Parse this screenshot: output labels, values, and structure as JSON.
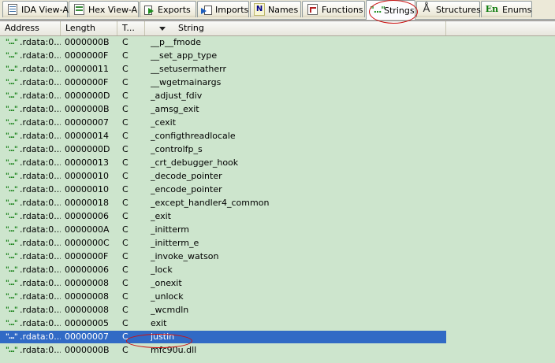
{
  "tabs": [
    {
      "label": "IDA View-A",
      "icon": "ida-view-icon",
      "active": false
    },
    {
      "label": "Hex View-A",
      "icon": "hex-view-icon",
      "active": false
    },
    {
      "label": "Exports",
      "icon": "exports-icon",
      "active": false
    },
    {
      "label": "Imports",
      "icon": "imports-icon",
      "active": false
    },
    {
      "label": "Names",
      "icon": "names-icon",
      "active": false
    },
    {
      "label": "Functions",
      "icon": "functions-icon",
      "active": false
    },
    {
      "label": "Strings",
      "icon": "strings-icon",
      "active": true
    },
    {
      "label": "Structures",
      "icon": "structures-icon",
      "active": false
    },
    {
      "label": "Enums",
      "icon": "enums-icon",
      "active": false
    }
  ],
  "tab_glyphs": {
    "names": "N",
    "strings": "\"...\"",
    "structures": "Å",
    "enums": "En"
  },
  "columns": {
    "address": "Address",
    "length": "Length",
    "type": "T...",
    "string": "String"
  },
  "row_icon": "\"...\"",
  "rows": [
    {
      "address": ".rdata:0...",
      "length": "0000000B",
      "type": "C",
      "string": "__p__fmode"
    },
    {
      "address": ".rdata:0...",
      "length": "0000000F",
      "type": "C",
      "string": "__set_app_type"
    },
    {
      "address": ".rdata:0...",
      "length": "00000011",
      "type": "C",
      "string": "__setusermatherr"
    },
    {
      "address": ".rdata:0...",
      "length": "0000000F",
      "type": "C",
      "string": "__wgetmainargs"
    },
    {
      "address": ".rdata:0...",
      "length": "0000000D",
      "type": "C",
      "string": "_adjust_fdiv"
    },
    {
      "address": ".rdata:0...",
      "length": "0000000B",
      "type": "C",
      "string": "_amsg_exit"
    },
    {
      "address": ".rdata:0...",
      "length": "00000007",
      "type": "C",
      "string": "_cexit"
    },
    {
      "address": ".rdata:0...",
      "length": "00000014",
      "type": "C",
      "string": "_configthreadlocale"
    },
    {
      "address": ".rdata:0...",
      "length": "0000000D",
      "type": "C",
      "string": "_controlfp_s"
    },
    {
      "address": ".rdata:0...",
      "length": "00000013",
      "type": "C",
      "string": "_crt_debugger_hook"
    },
    {
      "address": ".rdata:0...",
      "length": "00000010",
      "type": "C",
      "string": "_decode_pointer"
    },
    {
      "address": ".rdata:0...",
      "length": "00000010",
      "type": "C",
      "string": "_encode_pointer"
    },
    {
      "address": ".rdata:0...",
      "length": "00000018",
      "type": "C",
      "string": "_except_handler4_common"
    },
    {
      "address": ".rdata:0...",
      "length": "00000006",
      "type": "C",
      "string": "_exit"
    },
    {
      "address": ".rdata:0...",
      "length": "0000000A",
      "type": "C",
      "string": "_initterm"
    },
    {
      "address": ".rdata:0...",
      "length": "0000000C",
      "type": "C",
      "string": "_initterm_e"
    },
    {
      "address": ".rdata:0...",
      "length": "0000000F",
      "type": "C",
      "string": "_invoke_watson"
    },
    {
      "address": ".rdata:0...",
      "length": "00000006",
      "type": "C",
      "string": "_lock"
    },
    {
      "address": ".rdata:0...",
      "length": "00000008",
      "type": "C",
      "string": "_onexit"
    },
    {
      "address": ".rdata:0...",
      "length": "00000008",
      "type": "C",
      "string": "_unlock"
    },
    {
      "address": ".rdata:0...",
      "length": "00000008",
      "type": "C",
      "string": "_wcmdln"
    },
    {
      "address": ".rdata:0...",
      "length": "00000005",
      "type": "C",
      "string": "exit"
    },
    {
      "address": ".rdata:0...",
      "length": "00000007",
      "type": "C",
      "string": "justin",
      "selected": true
    },
    {
      "address": ".rdata:0...",
      "length": "0000000B",
      "type": "C",
      "string": "mfc90u.dll"
    }
  ],
  "colors": {
    "list_background": "#cde5cd",
    "selection": "#316ac5",
    "annotation": "#cc1111"
  }
}
